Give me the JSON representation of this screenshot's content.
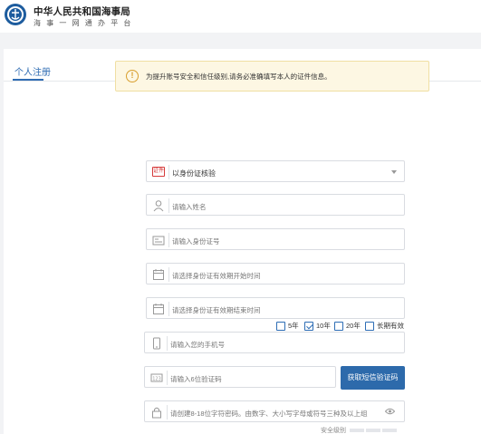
{
  "header": {
    "title": "中华人民共和国海事局",
    "subtitle": "海事一网通办平台",
    "logo_icon": "maritime-emblem-icon"
  },
  "tab": {
    "label": "个人注册"
  },
  "notice": {
    "icon": "warning-circle-icon",
    "text": "为提升账号安全和信任级别,请务必准确填写本人的证件信息。"
  },
  "form": {
    "id_type": {
      "value": "以身份证核验",
      "icon": "id-card-icon",
      "tag": "证件"
    },
    "name": {
      "placeholder": "请输入姓名",
      "icon": "user-icon"
    },
    "id_number": {
      "placeholder": "请输入身份证号",
      "icon": "id-number-icon"
    },
    "valid_start": {
      "placeholder": "请选择身份证有效期开始时间",
      "icon": "calendar-icon"
    },
    "valid_end": {
      "placeholder": "请选择身份证有效期结束时间",
      "icon": "calendar-icon"
    },
    "validity_options": [
      {
        "label": "5年",
        "checked": false
      },
      {
        "label": "10年",
        "checked": true
      },
      {
        "label": "20年",
        "checked": false
      },
      {
        "label": "长期有效",
        "checked": false
      }
    ],
    "phone": {
      "placeholder": "请输入您的手机号",
      "icon": "phone-icon"
    },
    "sms_code": {
      "placeholder": "请输入6位验证码",
      "icon": "sms-code-icon"
    },
    "sms_button": "获取短信验证码",
    "password": {
      "placeholder": "请创建8-18位字符密码。由数字、大小写字母或符号三种及以上组",
      "icon": "lock-icon",
      "toggle_icon": "eye-icon"
    },
    "strength_label": "安全级别"
  },
  "colors": {
    "primary": "#2d6aab",
    "warning": "#d89f2f",
    "notice_bg": "#fdf7e3"
  }
}
